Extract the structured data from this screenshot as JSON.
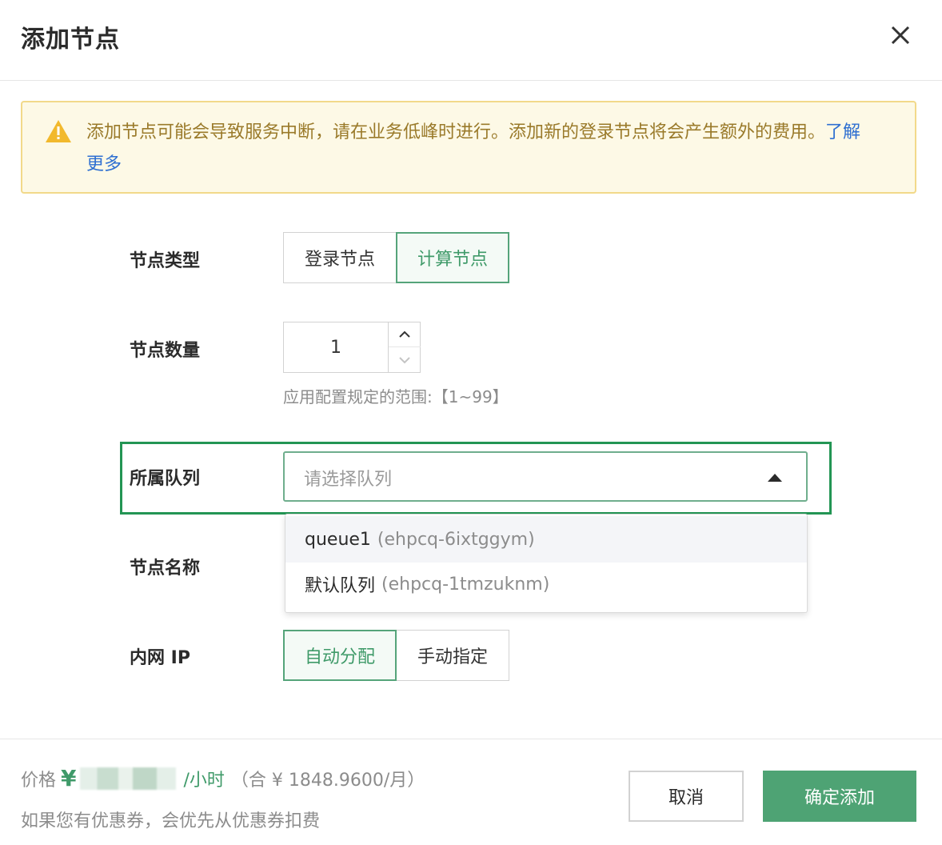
{
  "dialog": {
    "title": "添加节点"
  },
  "warning": {
    "text": "添加节点可能会导致服务中断，请在业务低峰时进行。添加新的登录节点将会产生额外的费用。",
    "link": "了解更多"
  },
  "form": {
    "node_type": {
      "label": "节点类型",
      "options": [
        "登录节点",
        "计算节点"
      ],
      "selected": "计算节点"
    },
    "node_count": {
      "label": "节点数量",
      "value": "1",
      "hint": "应用配置规定的范围:【1~99】"
    },
    "queue": {
      "label": "所属队列",
      "placeholder": "请选择队列",
      "options": [
        {
          "name": "queue1",
          "id": "(ehpcq-6ixtggym)"
        },
        {
          "name": "默认队列",
          "id": "(ehpcq-1tmzuknm)"
        }
      ]
    },
    "node_name": {
      "label": "节点名称"
    },
    "private_ip": {
      "label": "内网 IP",
      "options": [
        "自动分配",
        "手动指定"
      ],
      "selected": "自动分配"
    }
  },
  "footer": {
    "price_label": "价格",
    "currency": "¥",
    "unit": "/小时",
    "monthly": "（合 ¥ 1848.9600/月）",
    "coupon_note": "如果您有优惠券，会优先从优惠券扣费",
    "cancel": "取消",
    "confirm": "确定添加"
  },
  "colors": {
    "accent": "#4ea374",
    "warning_bg": "#fdf9e6",
    "warning_border": "#f2d98a",
    "link": "#2e6fd1",
    "highlight_box": "#239554"
  }
}
